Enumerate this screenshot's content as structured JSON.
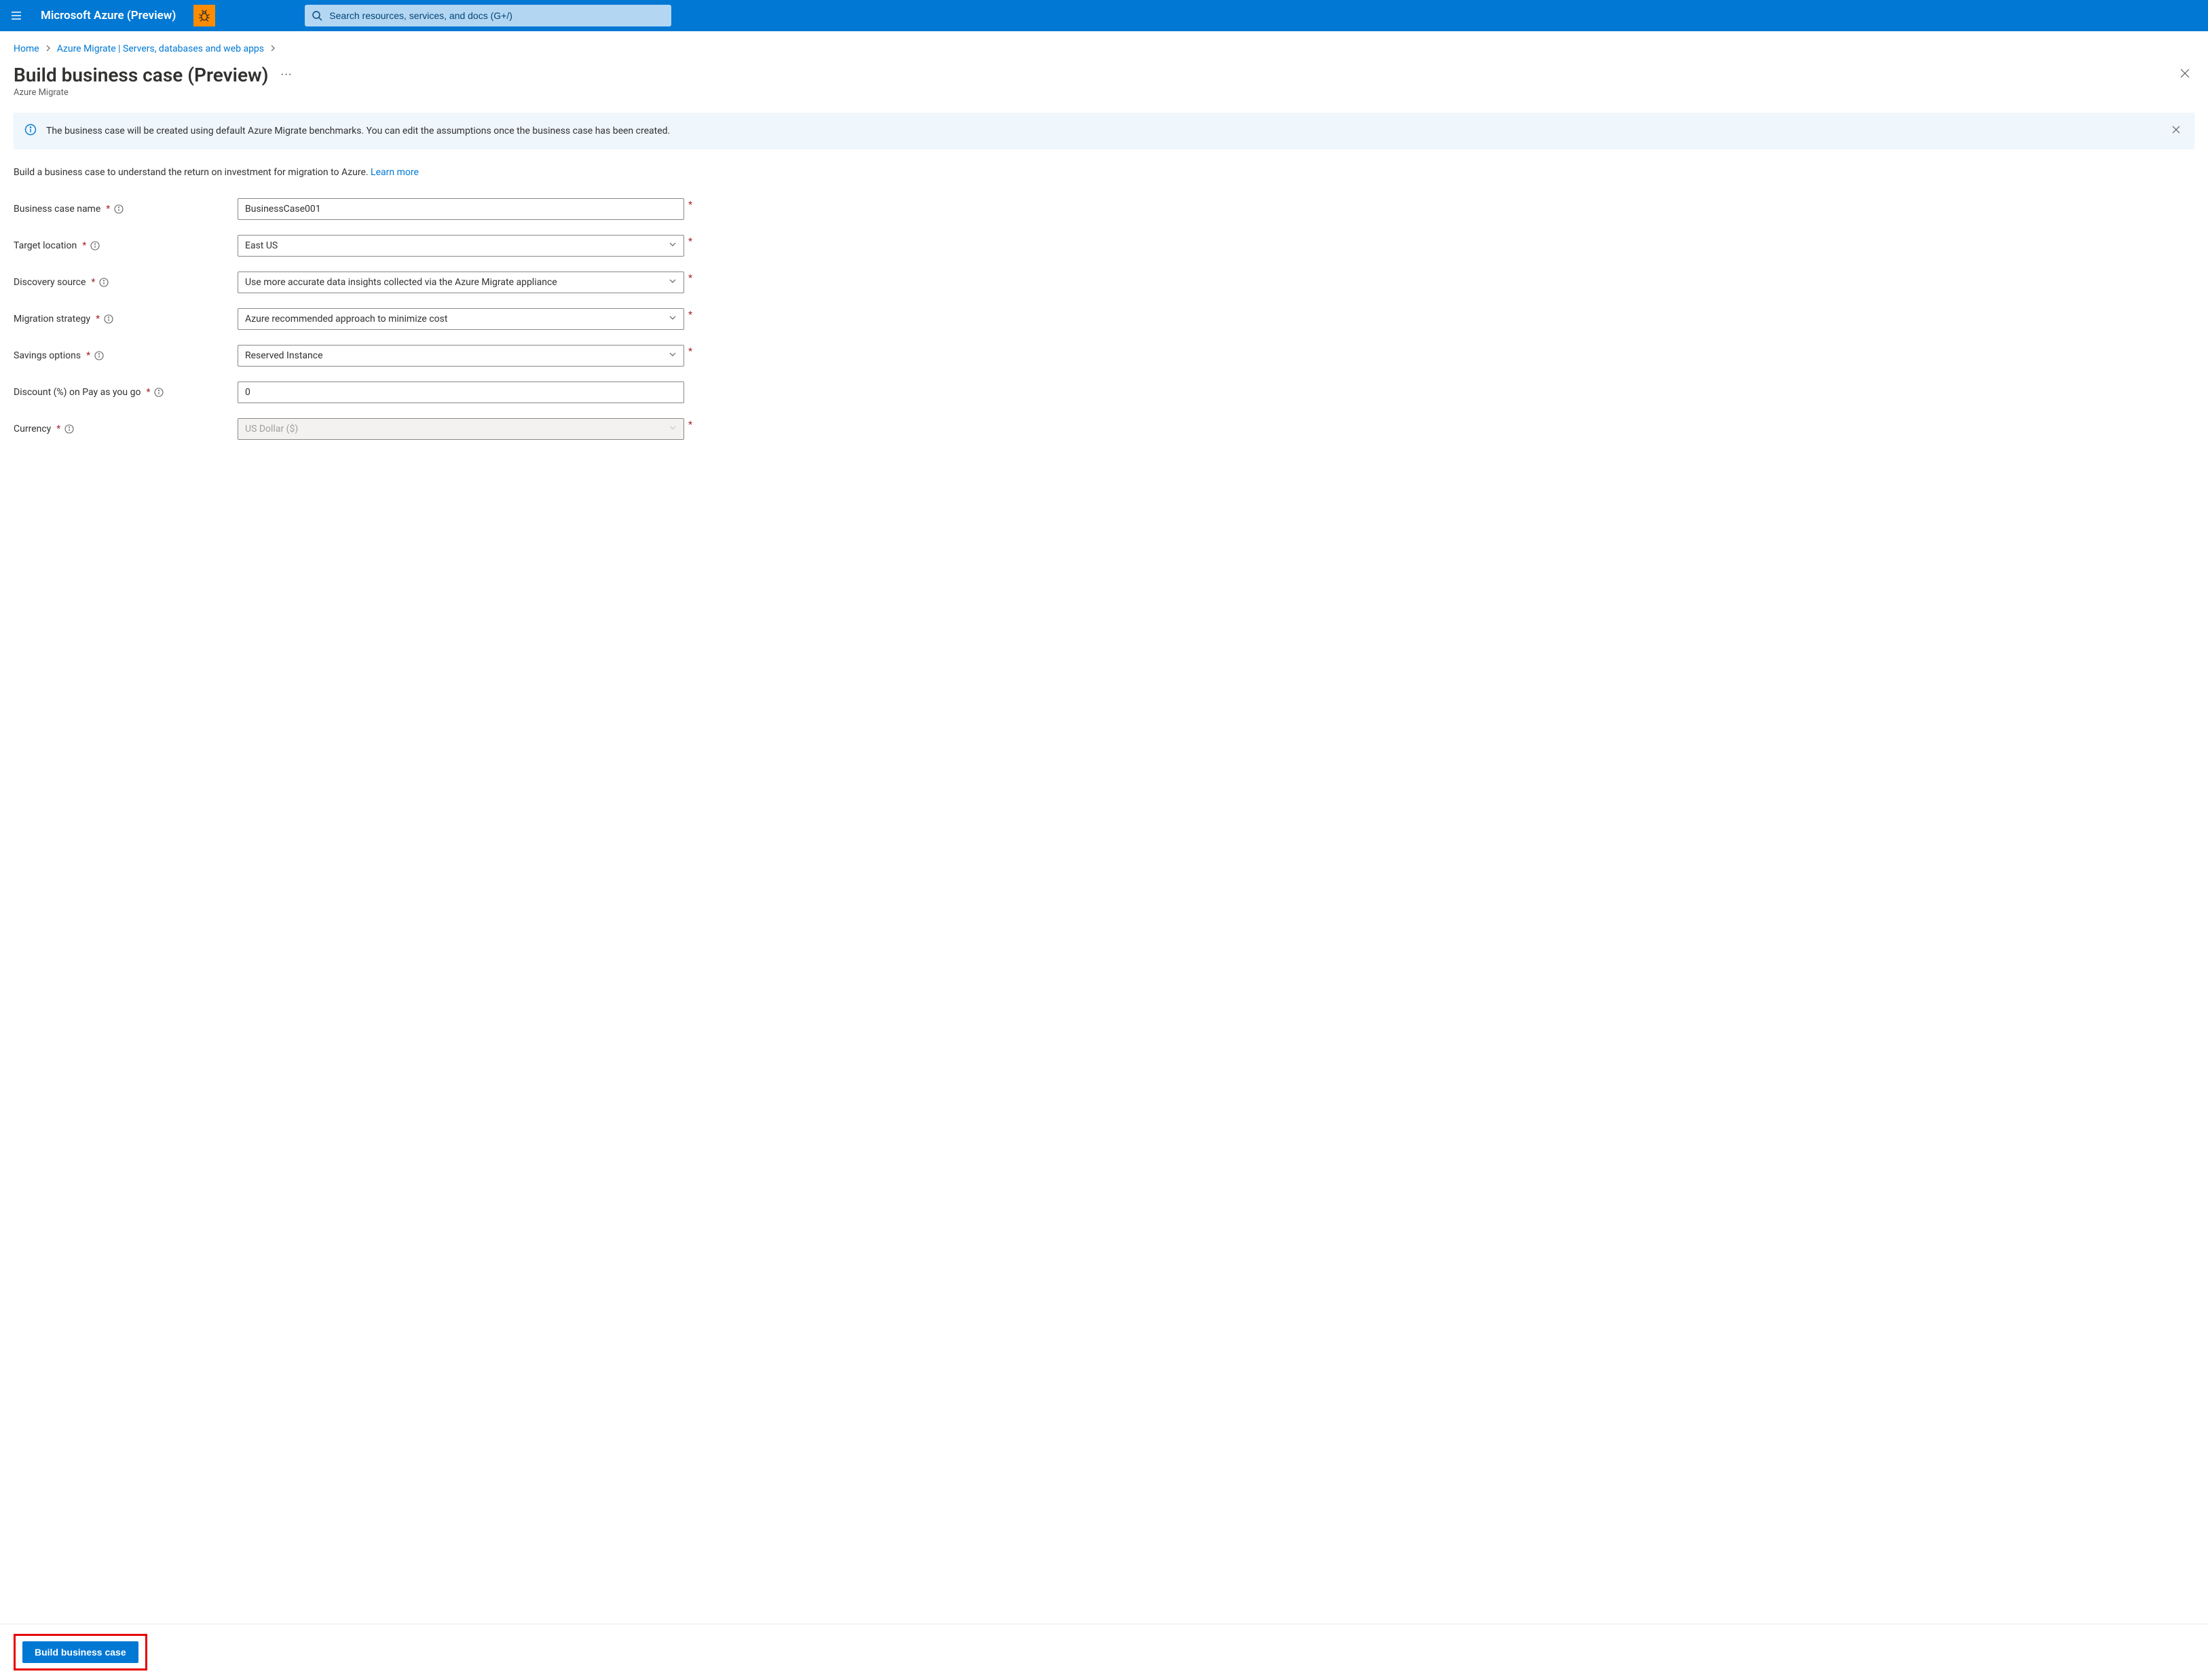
{
  "topbar": {
    "brand": "Microsoft Azure (Preview)",
    "search_placeholder": "Search resources, services, and docs (G+/)"
  },
  "breadcrumb": {
    "home": "Home",
    "migrate": "Azure Migrate | Servers, databases and web apps"
  },
  "heading": {
    "title": "Build business case (Preview)",
    "subtitle": "Azure Migrate"
  },
  "banner": {
    "text": "The business case will be created using default Azure Migrate benchmarks. You can edit the assumptions once the business case has been created."
  },
  "intro": {
    "text": "Build a business case to understand the return on investment for migration to Azure. ",
    "link": "Learn more"
  },
  "form": {
    "name": {
      "label": "Business case name",
      "value": "BusinessCase001"
    },
    "location": {
      "label": "Target location",
      "value": "East US"
    },
    "discovery": {
      "label": "Discovery source",
      "value": "Use more accurate data insights collected via the Azure Migrate appliance"
    },
    "strategy": {
      "label": "Migration strategy",
      "value": "Azure recommended approach to minimize cost"
    },
    "savings": {
      "label": "Savings options",
      "value": "Reserved Instance"
    },
    "discount": {
      "label": "Discount (%) on Pay as you go",
      "value": "0"
    },
    "currency": {
      "label": "Currency",
      "value": "US Dollar ($)"
    }
  },
  "footer": {
    "build": "Build business case"
  }
}
